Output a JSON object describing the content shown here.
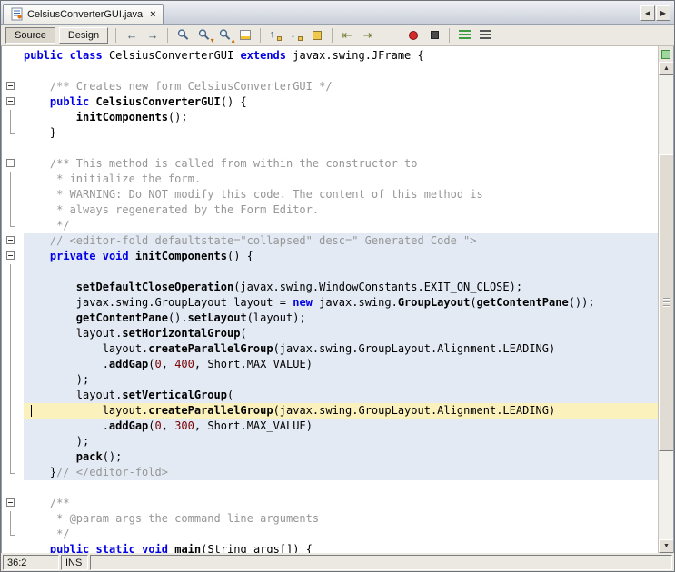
{
  "tabbar": {
    "tab_title": "CelsiusConverterGUI.java",
    "close_glyph": "×",
    "scroll_left_glyph": "◀",
    "scroll_right_glyph": "▶"
  },
  "toolbar": {
    "source_label": "Source",
    "design_label": "Design",
    "groups": [
      {
        "items": [
          {
            "name": "back-icon",
            "shape": "text",
            "glyph": "←",
            "color": "#4a5d75"
          },
          {
            "name": "forward-icon",
            "shape": "text",
            "glyph": "→",
            "color": "#4a5d75"
          }
        ]
      },
      {
        "items": [
          {
            "name": "find-selection-icon",
            "shape": "mag"
          },
          {
            "name": "find-next-occurrence-icon",
            "shape": "mag",
            "glyph": "▾"
          },
          {
            "name": "find-previous-occurrence-icon",
            "shape": "mag",
            "glyph": "▴"
          },
          {
            "name": "toggle-highlight-search-icon",
            "shape": "hl"
          }
        ]
      },
      {
        "items": [
          {
            "name": "previous-bookmark-icon",
            "shape": "bmprev"
          },
          {
            "name": "next-bookmark-icon",
            "shape": "bmnext"
          },
          {
            "name": "toggle-bookmark-icon",
            "shape": "bm"
          }
        ]
      },
      {
        "items": [
          {
            "name": "shift-line-left-icon",
            "shape": "text",
            "glyph": "⇤",
            "color": "#6d7a2f"
          },
          {
            "name": "shift-line-right-icon",
            "shape": "text",
            "glyph": "⇥",
            "color": "#6d7a2f"
          }
        ]
      },
      {
        "gap": true,
        "items": [
          {
            "name": "start-macro-recording-icon",
            "shape": "rec"
          },
          {
            "name": "stop-macro-recording-icon",
            "shape": "stop"
          }
        ]
      },
      {
        "items": [
          {
            "name": "comment-icon",
            "shape": "cmt",
            "color": "#3f9d3f"
          },
          {
            "name": "uncomment-icon",
            "shape": "cmt",
            "color": "#555555"
          }
        ]
      }
    ]
  },
  "editor": {
    "colors": {
      "keyword": "#0000e6",
      "comment": "#969696",
      "number": "#780000",
      "guard_bg": "#e3eaf4",
      "current_line_bg": "#fbf1bc"
    },
    "scrollbar": {
      "up_glyph": "▲",
      "down_glyph": "▼"
    },
    "lines": [
      {
        "g": "",
        "bg": "",
        "t": [
          [
            "k",
            "public"
          ],
          [
            "p",
            " "
          ],
          [
            "k",
            "class"
          ],
          [
            "p",
            " CelsiusConverterGUI "
          ],
          [
            "k",
            "extends"
          ],
          [
            "p",
            " javax.swing.JFrame {"
          ]
        ]
      },
      {
        "g": "",
        "bg": "",
        "t": []
      },
      {
        "g": "start",
        "bg": "",
        "t": [
          [
            "c",
            "    /** Creates new form CelsiusConverterGUI */"
          ]
        ]
      },
      {
        "g": "start",
        "bg": "",
        "t": [
          [
            "p",
            "    "
          ],
          [
            "k",
            "public"
          ],
          [
            "p",
            " "
          ],
          [
            "m",
            "CelsiusConverterGUI"
          ],
          [
            "p",
            "() {"
          ]
        ]
      },
      {
        "g": "mid",
        "bg": "",
        "t": [
          [
            "p",
            "        "
          ],
          [
            "m",
            "initComponents"
          ],
          [
            "p",
            "();"
          ]
        ]
      },
      {
        "g": "end",
        "bg": "",
        "t": [
          [
            "p",
            "    }"
          ]
        ]
      },
      {
        "g": "",
        "bg": "",
        "t": []
      },
      {
        "g": "start",
        "bg": "",
        "t": [
          [
            "c",
            "    /** This method is called from within the constructor to"
          ]
        ]
      },
      {
        "g": "mid",
        "bg": "",
        "t": [
          [
            "c",
            "     * initialize the form."
          ]
        ]
      },
      {
        "g": "mid",
        "bg": "",
        "t": [
          [
            "c",
            "     * WARNING: Do NOT modify this code. The content of this method is"
          ]
        ]
      },
      {
        "g": "mid",
        "bg": "",
        "t": [
          [
            "c",
            "     * always regenerated by the Form Editor."
          ]
        ]
      },
      {
        "g": "end",
        "bg": "",
        "t": [
          [
            "c",
            "     */"
          ]
        ]
      },
      {
        "g": "start",
        "bg": "guard",
        "t": [
          [
            "c",
            "    // <editor-fold defaultstate=\"collapsed\" desc=\" Generated Code \">"
          ]
        ]
      },
      {
        "g": "start",
        "bg": "guard",
        "t": [
          [
            "p",
            "    "
          ],
          [
            "k",
            "private"
          ],
          [
            "p",
            " "
          ],
          [
            "k",
            "void"
          ],
          [
            "p",
            " "
          ],
          [
            "m",
            "initComponents"
          ],
          [
            "p",
            "() {"
          ]
        ]
      },
      {
        "g": "mid",
        "bg": "guard",
        "t": []
      },
      {
        "g": "mid",
        "bg": "guard",
        "t": [
          [
            "p",
            "        "
          ],
          [
            "m",
            "setDefaultCloseOperation"
          ],
          [
            "p",
            "(javax.swing.WindowConstants.EXIT_ON_CLOSE);"
          ]
        ]
      },
      {
        "g": "mid",
        "bg": "guard",
        "t": [
          [
            "p",
            "        javax.swing.GroupLayout layout = "
          ],
          [
            "k",
            "new"
          ],
          [
            "p",
            " javax.swing."
          ],
          [
            "m",
            "GroupLayout"
          ],
          [
            "p",
            "("
          ],
          [
            "m",
            "getContentPane"
          ],
          [
            "p",
            "());"
          ]
        ]
      },
      {
        "g": "mid",
        "bg": "guard",
        "t": [
          [
            "p",
            "        "
          ],
          [
            "m",
            "getContentPane"
          ],
          [
            "p",
            "()."
          ],
          [
            "m",
            "setLayout"
          ],
          [
            "p",
            "(layout);"
          ]
        ]
      },
      {
        "g": "mid",
        "bg": "guard",
        "t": [
          [
            "p",
            "        layout."
          ],
          [
            "m",
            "setHorizontalGroup"
          ],
          [
            "p",
            "("
          ]
        ]
      },
      {
        "g": "mid",
        "bg": "guard",
        "t": [
          [
            "p",
            "            layout."
          ],
          [
            "m",
            "createParallelGroup"
          ],
          [
            "p",
            "(javax.swing.GroupLayout.Alignment.LEADING)"
          ]
        ]
      },
      {
        "g": "mid",
        "bg": "guard",
        "t": [
          [
            "p",
            "            ."
          ],
          [
            "m",
            "addGap"
          ],
          [
            "p",
            "("
          ],
          [
            "n",
            "0"
          ],
          [
            "p",
            ", "
          ],
          [
            "n",
            "400"
          ],
          [
            "p",
            ", Short.MAX_VALUE)"
          ]
        ]
      },
      {
        "g": "mid",
        "bg": "guard",
        "t": [
          [
            "p",
            "        );"
          ]
        ]
      },
      {
        "g": "mid",
        "bg": "guard",
        "t": [
          [
            "p",
            "        layout."
          ],
          [
            "m",
            "setVerticalGroup"
          ],
          [
            "p",
            "("
          ]
        ]
      },
      {
        "g": "mid",
        "bg": "guard current",
        "caret": true,
        "t": [
          [
            "p",
            "            layout."
          ],
          [
            "m",
            "createParallelGroup"
          ],
          [
            "p",
            "(javax.swing.GroupLayout.Alignment.LEADING)"
          ]
        ]
      },
      {
        "g": "mid",
        "bg": "guard",
        "t": [
          [
            "p",
            "            ."
          ],
          [
            "m",
            "addGap"
          ],
          [
            "p",
            "("
          ],
          [
            "n",
            "0"
          ],
          [
            "p",
            ", "
          ],
          [
            "n",
            "300"
          ],
          [
            "p",
            ", Short.MAX_VALUE)"
          ]
        ]
      },
      {
        "g": "mid",
        "bg": "guard",
        "t": [
          [
            "p",
            "        );"
          ]
        ]
      },
      {
        "g": "mid",
        "bg": "guard",
        "t": [
          [
            "p",
            "        "
          ],
          [
            "m",
            "pack"
          ],
          [
            "p",
            "();"
          ]
        ]
      },
      {
        "g": "end",
        "bg": "guard",
        "t": [
          [
            "p",
            "    }"
          ],
          [
            "c",
            "// </editor-fold>"
          ]
        ]
      },
      {
        "g": "",
        "bg": "",
        "t": []
      },
      {
        "g": "start",
        "bg": "",
        "t": [
          [
            "c",
            "    /**"
          ]
        ]
      },
      {
        "g": "mid",
        "bg": "",
        "t": [
          [
            "c",
            "     * @param args the command line arguments"
          ]
        ]
      },
      {
        "g": "end",
        "bg": "",
        "t": [
          [
            "c",
            "     */"
          ]
        ]
      },
      {
        "g": "",
        "bg": "",
        "t": [
          [
            "p",
            "    "
          ],
          [
            "k",
            "public"
          ],
          [
            "p",
            " "
          ],
          [
            "k",
            "static"
          ],
          [
            "p",
            " "
          ],
          [
            "k",
            "void"
          ],
          [
            "p",
            " "
          ],
          [
            "m",
            "main"
          ],
          [
            "p",
            "(String args[]) {"
          ]
        ]
      }
    ]
  },
  "status": {
    "caret_position": "36:2",
    "mode": "INS"
  }
}
